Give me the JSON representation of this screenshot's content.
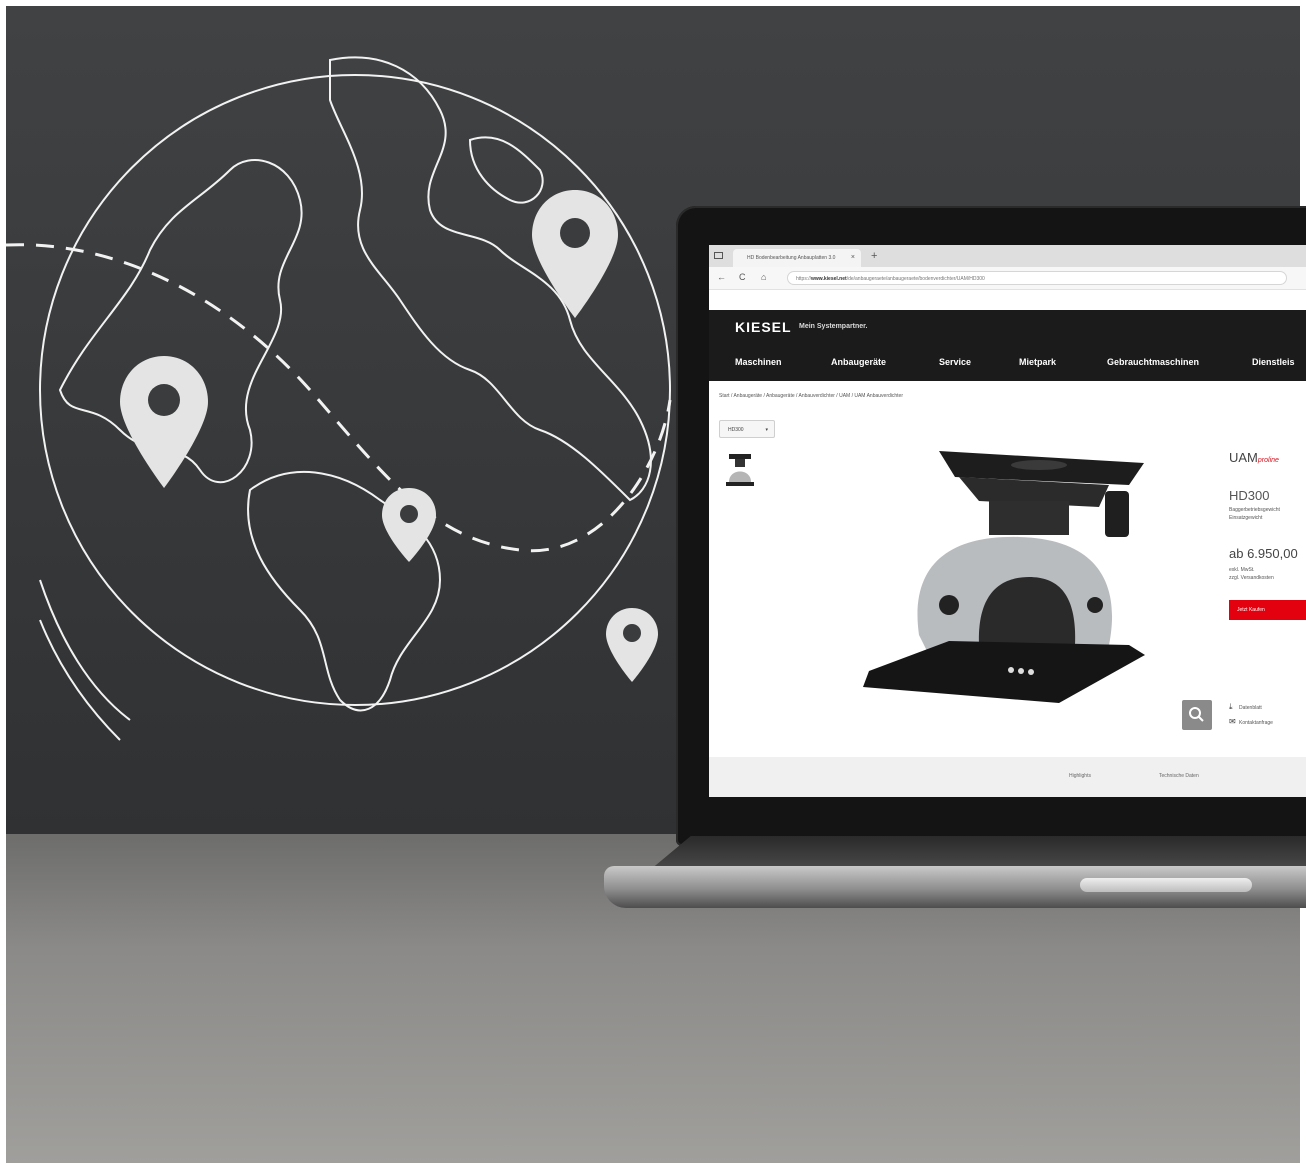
{
  "browser": {
    "tab_title": "HD Bodenbearbeitung Anbauplatten 3.0",
    "tab_close": "×",
    "new_tab": "+",
    "nav_back": "←",
    "nav_reload": "C",
    "nav_home": "⌂",
    "url_prefix": "https://",
    "url_domain": "www.kiesel.net",
    "url_path": "/de/anbaugeraete/anbaugeraete/bodenverdichter/UAM/HD300"
  },
  "site": {
    "logo": "KIESEL",
    "tagline": "Mein Systempartner.",
    "nav": [
      "Maschinen",
      "Anbaugeräte",
      "Service",
      "Mietpark",
      "Gebrauchtmaschinen",
      "Dienstleis"
    ],
    "breadcrumb": "Start  /  Anbaugeräte  /  Anbaugeräte  /  Anbauverdichter  /  UAM  /  UAM Anbauverdichter"
  },
  "product": {
    "variant_select": "HD300",
    "brand_main": "UAM",
    "brand_sub": "proline",
    "model": "HD300",
    "spec_line1": "Baggerbetriebsgewicht",
    "spec_line2": "Einsatzgewicht",
    "price": "ab 6.950,00",
    "tax_line1": "exkl. MwSt.",
    "tax_line2": "zzgl. Versandkosten",
    "buy_label": "Jetzt Kaufen",
    "link_download": "Datenblatt",
    "link_contact": "Kontaktanfrage",
    "tab_highlights": "Highlights",
    "tab_specs": "Technische Daten"
  },
  "colors": {
    "accent": "#e3000f",
    "header_bg": "#1b1b1b",
    "wall": "#3a3c3e",
    "desk": "#8b8a88"
  }
}
